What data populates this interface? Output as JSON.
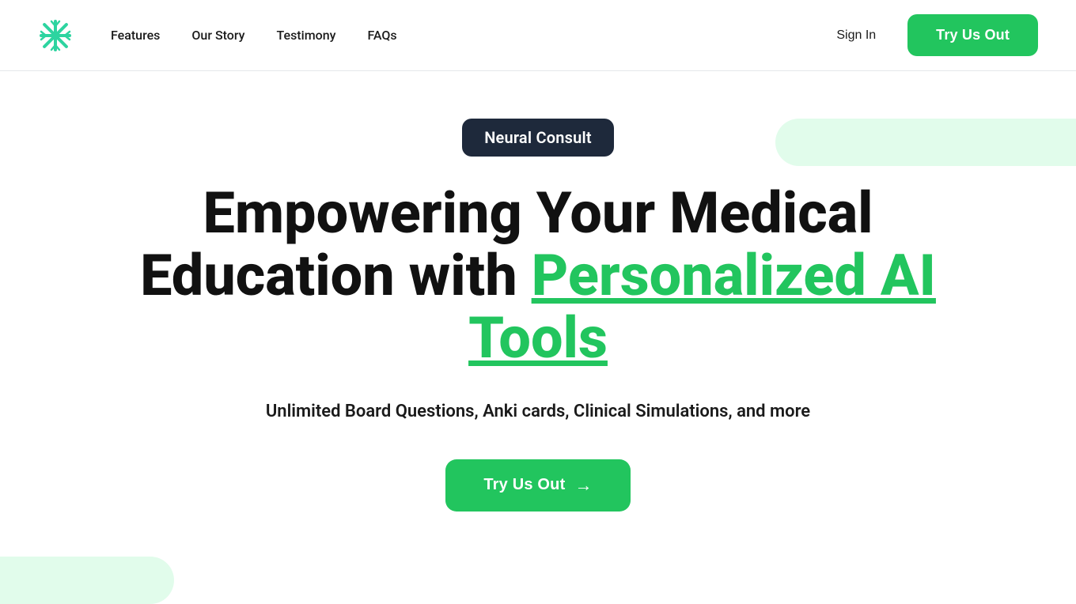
{
  "nav": {
    "logo_alt": "Neural Consult Logo",
    "links": [
      {
        "label": "Features",
        "href": "#"
      },
      {
        "label": "Our Story",
        "href": "#"
      },
      {
        "label": "Testimony",
        "href": "#"
      },
      {
        "label": "FAQs",
        "href": "#"
      }
    ],
    "sign_in": "Sign In",
    "try_btn": "Try Us Out"
  },
  "hero": {
    "badge": "Neural Consult",
    "headline_part1": "Empowering Your Medical Education with ",
    "headline_colored": "Personalized AI Tools",
    "subtitle": "Unlimited Board Questions, Anki cards, Clinical Simulations, and more",
    "cta_label": "Try Us Out",
    "cta_arrow": "→"
  }
}
